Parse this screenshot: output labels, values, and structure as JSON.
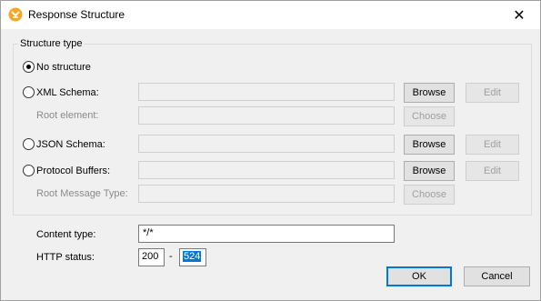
{
  "window": {
    "title": "Response Structure",
    "icon": "altova-app-icon",
    "close_glyph": "✕"
  },
  "structure_type": {
    "legend": "Structure type",
    "options": [
      {
        "label": "No structure",
        "checked": true
      },
      {
        "label": "XML Schema:",
        "checked": false
      },
      {
        "label": "JSON Schema:",
        "checked": false
      },
      {
        "label": "Protocol Buffers:",
        "checked": false
      }
    ],
    "root_element_label": "Root element:",
    "root_message_type_label": "Root Message Type:"
  },
  "buttons": {
    "browse": "Browse",
    "edit": "Edit",
    "choose": "Choose",
    "ok": "OK",
    "cancel": "Cancel"
  },
  "content_type": {
    "label": "Content type:",
    "value": "*/*"
  },
  "http_status": {
    "label": "HTTP status:",
    "from": "200",
    "separator": "-",
    "to": "524"
  },
  "colors": {
    "accent": "#0078d7",
    "icon_orange": "#f5a623"
  }
}
